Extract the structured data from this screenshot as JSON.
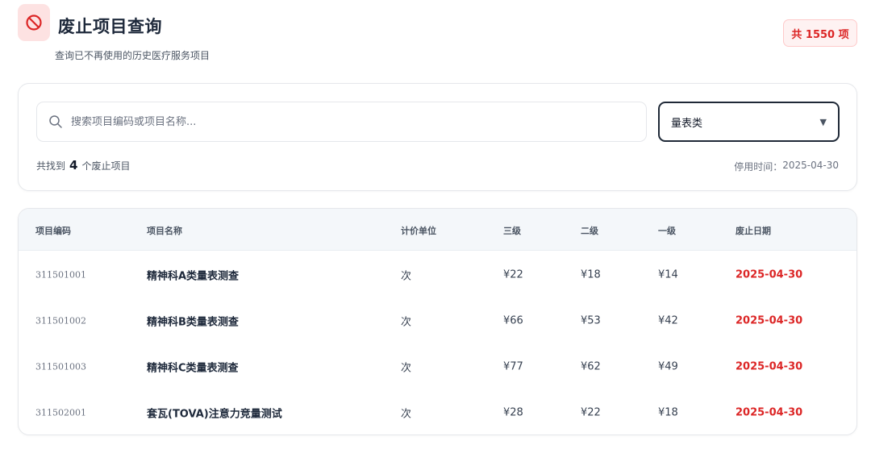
{
  "header": {
    "title": "废止项目查询",
    "subtitle": "查询已不再使用的历史医疗服务项目",
    "icon": "prohibited-icon",
    "count_badge": "共 1550 项"
  },
  "filter": {
    "search": {
      "value": "",
      "placeholder": "搜索项目编码或项目名称..."
    },
    "category": {
      "selected": "量表类"
    },
    "summary": {
      "prefix": "共找到",
      "count": "4",
      "suffix": "个废止项目"
    },
    "stop_time": {
      "label": "停用时间：",
      "value": "2025-04-30"
    }
  },
  "table": {
    "columns": [
      "项目编码",
      "项目名称",
      "计价单位",
      "三级",
      "二级",
      "一级",
      "废止日期"
    ],
    "rows": [
      {
        "code": "311501001",
        "name": "精神科A类量表测查",
        "unit": "次",
        "level3": "¥22",
        "level2": "¥18",
        "level1": "¥14",
        "date": "2025-04-30"
      },
      {
        "code": "311501002",
        "name": "精神科B类量表测查",
        "unit": "次",
        "level3": "¥66",
        "level2": "¥53",
        "level1": "¥42",
        "date": "2025-04-30"
      },
      {
        "code": "311501003",
        "name": "精神科C类量表测查",
        "unit": "次",
        "level3": "¥77",
        "level2": "¥62",
        "level1": "¥49",
        "date": "2025-04-30"
      },
      {
        "code": "311502001",
        "name": "套瓦(TOVA)注意力竞量测试",
        "unit": "次",
        "level3": "¥28",
        "level2": "¥22",
        "level1": "¥18",
        "date": "2025-04-30"
      }
    ]
  },
  "colors": {
    "accent_red": "#dc2626",
    "badge_bg": "#fef2f2",
    "icon_bg": "#fde2e2",
    "header_bg": "#f4f7fa"
  }
}
